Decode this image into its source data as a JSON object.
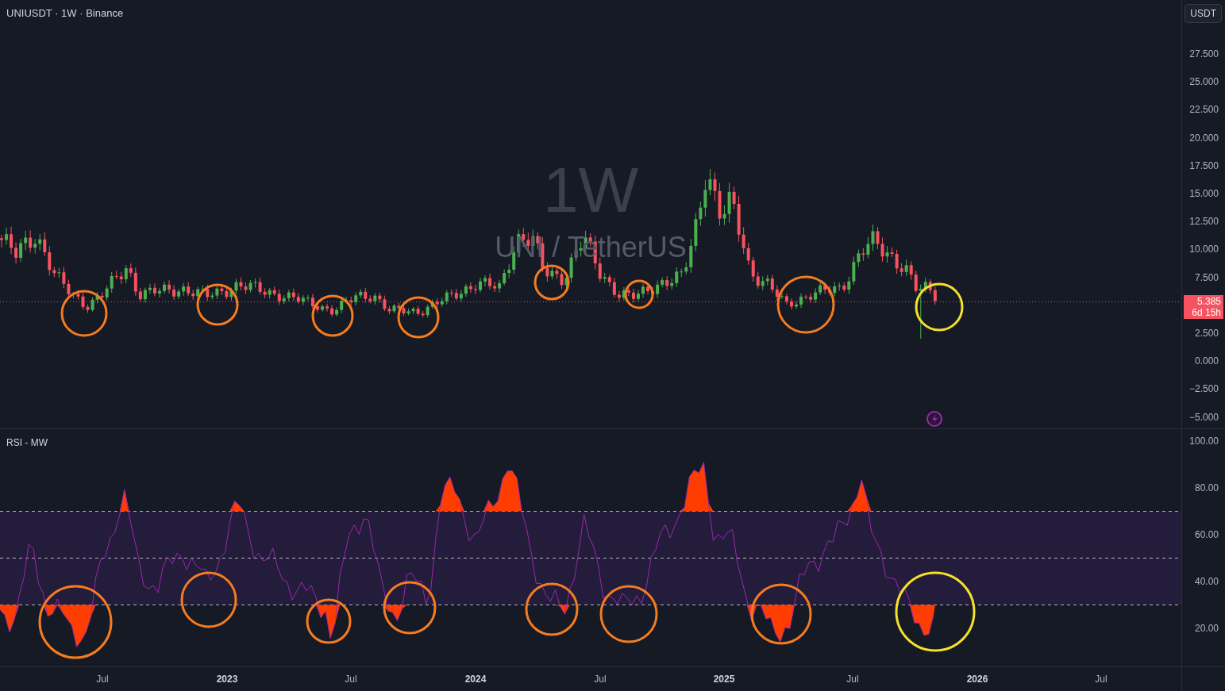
{
  "header": {
    "title": "UNIUSDT · 1W · Binance"
  },
  "currency_button": "USDT",
  "watermark": {
    "interval": "1W",
    "symbol": "UNI / TetherUS"
  },
  "price_axis": {
    "ticks": [
      "27.500",
      "25.000",
      "22.500",
      "20.000",
      "17.500",
      "15.000",
      "12.500",
      "10.000",
      "7.500",
      "2.500",
      "0.000",
      "−2.500",
      "−5.000"
    ],
    "last_price": "5.385",
    "countdown": "6d 15h"
  },
  "rsi_pane": {
    "title": "RSI - MW",
    "ticks": [
      "100.00",
      "80.00",
      "60.00",
      "40.00",
      "20.00"
    ]
  },
  "time_axis": [
    {
      "label": "Jul",
      "kind": "month"
    },
    {
      "label": "2023",
      "kind": "year"
    },
    {
      "label": "Jul",
      "kind": "month"
    },
    {
      "label": "2024",
      "kind": "year"
    },
    {
      "label": "Jul",
      "kind": "month"
    },
    {
      "label": "2025",
      "kind": "year"
    },
    {
      "label": "Jul",
      "kind": "month"
    },
    {
      "label": "2026",
      "kind": "year"
    },
    {
      "label": "Jul",
      "kind": "month"
    }
  ]
}
